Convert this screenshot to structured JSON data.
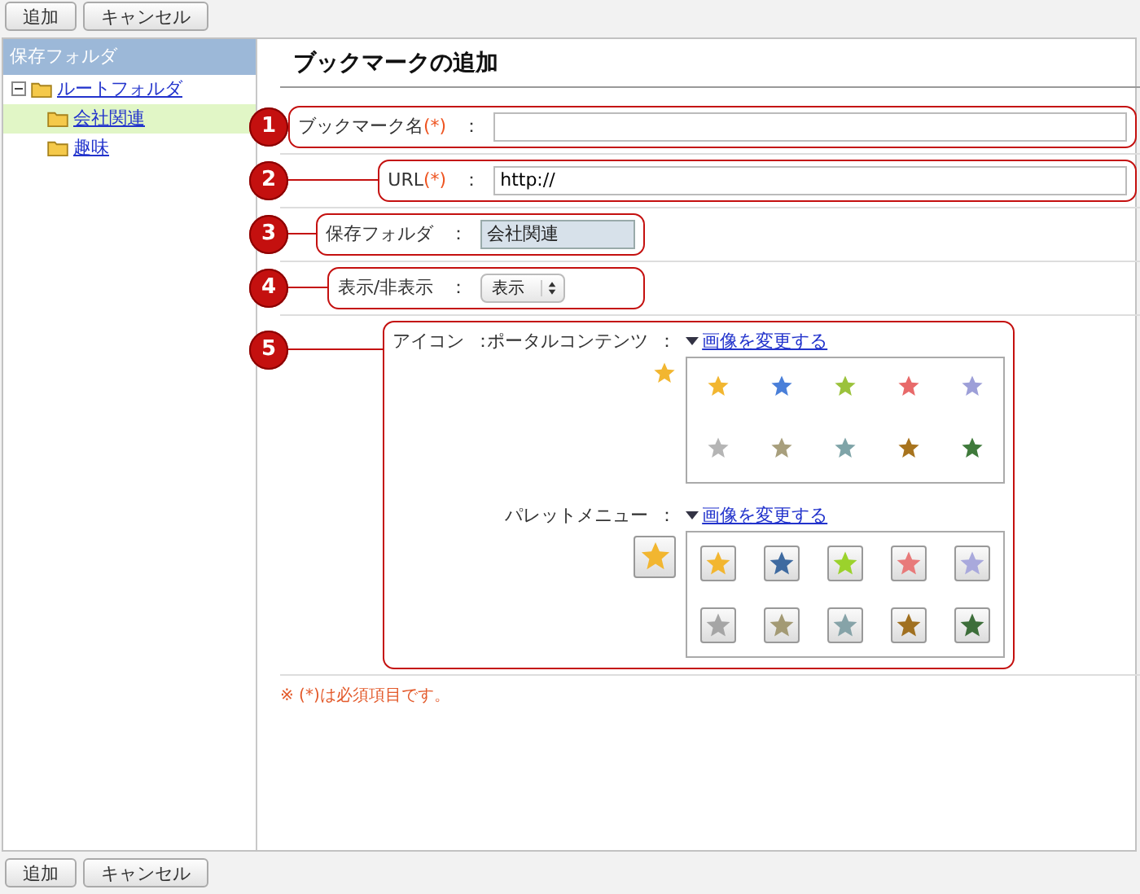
{
  "toolbar_top": {
    "buttons": [
      "追加",
      "キャンセル"
    ]
  },
  "sidebar": {
    "title": "保存フォルダ",
    "tree": [
      {
        "label": "ルートフォルダ",
        "expanded": true,
        "selected": false,
        "children": [
          {
            "label": "会社関連",
            "selected": true
          },
          {
            "label": "趣味",
            "selected": false
          }
        ]
      }
    ]
  },
  "form": {
    "title": "ブックマークの追加",
    "rows": [
      {
        "kind": "text",
        "callout": "1",
        "label": "ブックマーク名",
        "required_mark": "(*)",
        "colon": "："
      },
      {
        "kind": "text",
        "callout": "2",
        "label": "URL",
        "required_mark": "(*)",
        "colon": "：",
        "value": "http://"
      },
      {
        "kind": "readonly",
        "callout": "3",
        "label": "保存フォルダ",
        "colon": "：",
        "value": "会社関連"
      },
      {
        "kind": "select",
        "callout": "4",
        "label": "表示/非表示",
        "colon": "：",
        "value": "表示"
      },
      {
        "kind": "icons",
        "callout": "5",
        "label": "アイコン",
        "colon": "：",
        "sections": [
          {
            "kind": "plain",
            "label": "ポータルコンテンツ",
            "colon": "：",
            "link": "画像を変更する",
            "preview": {
              "color": "#f2b630"
            },
            "choices": [
              {
                "color": "#f2b630"
              },
              {
                "color": "#4a7fd9"
              },
              {
                "color": "#9bc23c"
              },
              {
                "color": "#e86a6a"
              },
              {
                "color": "#9d9fd8"
              },
              {
                "color": "#b5b5b5"
              },
              {
                "color": "#a89f7d"
              },
              {
                "color": "#7fa4a8"
              },
              {
                "color": "#a8741e"
              },
              {
                "color": "#3f7a3b"
              }
            ]
          },
          {
            "kind": "tile",
            "label": "パレットメニュー",
            "colon": "：",
            "link": "画像を変更する",
            "preview": {
              "color": "#f2b630"
            },
            "choices": [
              {
                "color": "#f2b630"
              },
              {
                "color": "#3e6aa0"
              },
              {
                "color": "#9bd22c"
              },
              {
                "color": "#e87a7a"
              },
              {
                "color": "#a9a9dc"
              },
              {
                "color": "#a5a5a5"
              },
              {
                "color": "#a39a74"
              },
              {
                "color": "#86a3a8"
              },
              {
                "color": "#a07020"
              },
              {
                "color": "#3d6e3a"
              }
            ]
          }
        ]
      }
    ],
    "note": "※ (*)は必須項目です。"
  },
  "toolbar_bottom": {
    "buttons": [
      "追加",
      "キャンセル"
    ]
  }
}
